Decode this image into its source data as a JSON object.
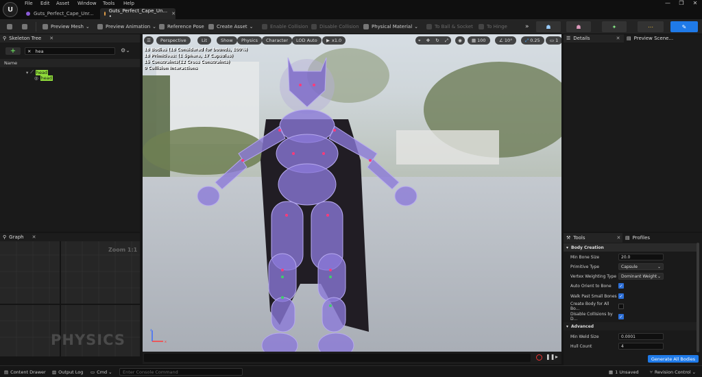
{
  "menu": [
    "File",
    "Edit",
    "Asset",
    "Window",
    "Tools",
    "Help"
  ],
  "tabs": [
    {
      "label": "Guts_Perfect_Cape_Unr...",
      "color": "#8a5bd6"
    },
    {
      "label": "Guts_Perfect_Cape_Un... •",
      "color": "#e8a24a"
    }
  ],
  "window_controls": [
    "—",
    "❐",
    "✕"
  ],
  "toolbar": {
    "preview_mesh": "Preview Mesh",
    "preview_animation": "Preview Animation",
    "reference_pose": "Reference Pose",
    "create_asset": "Create Asset",
    "enable_collision": "Enable Collision",
    "disable_collision": "Disable Collision",
    "physical_material": "Physical Material",
    "to_ball_socket": "To Ball & Socket",
    "to_hinge": "To Hinge"
  },
  "skeleton_tree": {
    "title": "Skeleton Tree",
    "search_value": "hea",
    "column": "Name",
    "items": [
      "head",
      "head"
    ]
  },
  "graph": {
    "title": "Graph",
    "zoom": "Zoom 1:1",
    "watermark": "PHYSICS"
  },
  "viewport": {
    "buttons": [
      "Perspective",
      "Lit",
      "Show",
      "Physics",
      "Character",
      "LOD Auto",
      "x1.0"
    ],
    "right_values": [
      "100",
      "10°",
      "0.25",
      "1"
    ],
    "stats": [
      "18 Bodies (18 Considered for bounds, 100%)",
      "18 Primitives: (1 Sphere, 17 Capsules)",
      "15 Constraints(12 Cross Constraints)",
      "0 Collision Interactions"
    ]
  },
  "details": {
    "details_tab": "Details",
    "preview_tab": "Preview Scene..."
  },
  "tools": {
    "tools_tab": "Tools",
    "profiles_tab": "Profiles",
    "section_body": "Body Creation",
    "min_bone_size_label": "Min Bone Size",
    "min_bone_size": "20.0",
    "primitive_type_label": "Primitive Type",
    "primitive_type": "Capsule",
    "vertex_weighting_label": "Vertex Weighting Type",
    "vertex_weighting": "Dominant Weight",
    "auto_orient_label": "Auto Orient to Bone",
    "walk_past_label": "Walk Past Small Bones",
    "create_body_label": "Create Body for All Bo...",
    "disable_coll_label": "Disable Collisions by D...",
    "section_advanced": "Advanced",
    "min_weld_label": "Min Weld Size",
    "min_weld": "0.0001",
    "hull_count_label": "Hull Count",
    "hull_count": "4",
    "generate": "Generate All Bodies"
  },
  "status": {
    "content_drawer": "Content Drawer",
    "output_log": "Output Log",
    "cmd": "Cmd",
    "console_placeholder": "Enter Console Command",
    "unsaved": "1 Unsaved",
    "revision": "Revision Control"
  }
}
